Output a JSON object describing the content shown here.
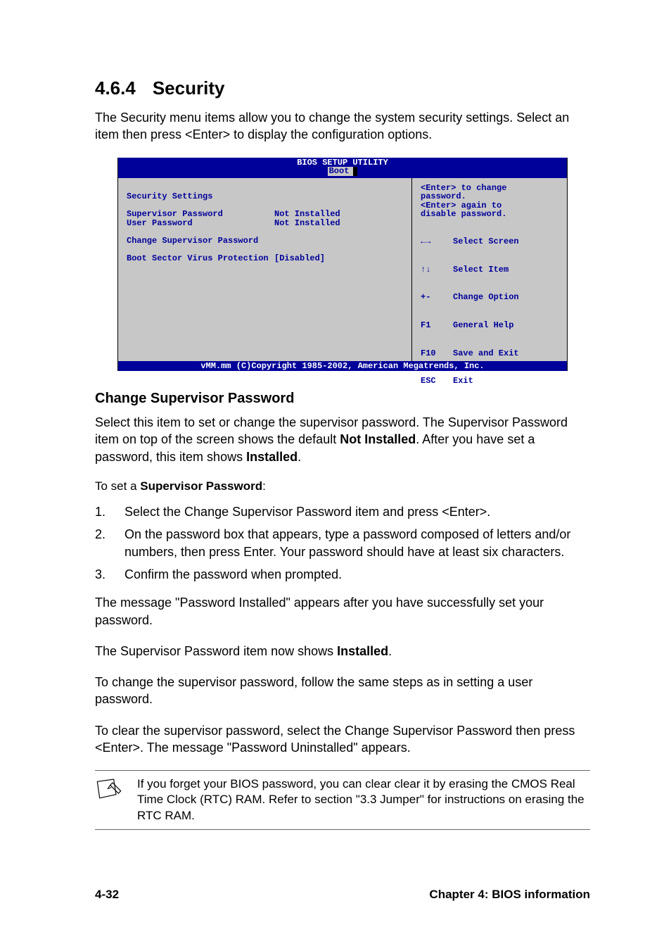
{
  "section": {
    "number": "4.6.4",
    "title": "Security"
  },
  "intro": "The Security menu items allow you to change the system security settings. Select an item then press <Enter> to display the configuration options.",
  "bios": {
    "title": "BIOS SETUP UTILITY",
    "tab": "Boot",
    "heading": "Security Settings",
    "rows": {
      "supervisor_label": "Supervisor Password",
      "supervisor_value": "Not Installed",
      "user_label": "User Password",
      "user_value": "Not Installed",
      "change_supervisor": "Change Supervisor Password",
      "boot_sector_label": "Boot Sector Virus Protection",
      "boot_sector_value": "[Disabled]"
    },
    "help": {
      "line1": "<Enter> to change",
      "line2": "password.",
      "line3": "<Enter> again to",
      "line4": "disable password."
    },
    "nav": {
      "lr": {
        "key": "←→",
        "label": "Select Screen"
      },
      "ud": {
        "key": "↑↓",
        "label": "Select Item"
      },
      "pm": {
        "key": "+-",
        "label": "Change Option"
      },
      "f1": {
        "key": "F1",
        "label": "General Help"
      },
      "f10": {
        "key": "F10",
        "label": "Save and Exit"
      },
      "esc": {
        "key": "ESC",
        "label": "Exit"
      }
    },
    "copyright": "vMM.mm (C)Copyright 1985-2002, American Megatrends, Inc."
  },
  "subheading": "Change Supervisor Password",
  "para1_a": "Select this item to set or change the supervisor password. The Supervisor Password item on top of the screen shows the default ",
  "para1_bold1": "Not Installed",
  "para1_b": ". After you have set a password, this item shows ",
  "para1_bold2": "Installed",
  "para1_c": ".",
  "to_set_prefix": "To set a ",
  "to_set_bold": "Supervisor Password",
  "to_set_suffix": ":",
  "steps": [
    "Select the Change Supervisor Password item and press <Enter>.",
    "On the password box that appears, type a password composed of letters and/or numbers, then press Enter. Your password should have at least six characters.",
    "Confirm the password when prompted."
  ],
  "para2": "The message \"Password Installed\" appears after you have successfully set your password.",
  "para3_a": "The Supervisor Password item now shows ",
  "para3_bold": "Installed",
  "para3_b": ".",
  "para4": "To change the supervisor password, follow the same steps as in setting a user password.",
  "para5": "To clear the supervisor password, select the Change Supervisor Password then press <Enter>. The message \"Password Uninstalled\" appears.",
  "note": "If you forget your BIOS password, you can clear clear it by erasing the CMOS Real Time Clock (RTC) RAM. Refer to section \"3.3 Jumper\" for instructions on erasing the RTC RAM.",
  "footer": {
    "page": "4-32",
    "chapter": "Chapter 4: BIOS information"
  }
}
